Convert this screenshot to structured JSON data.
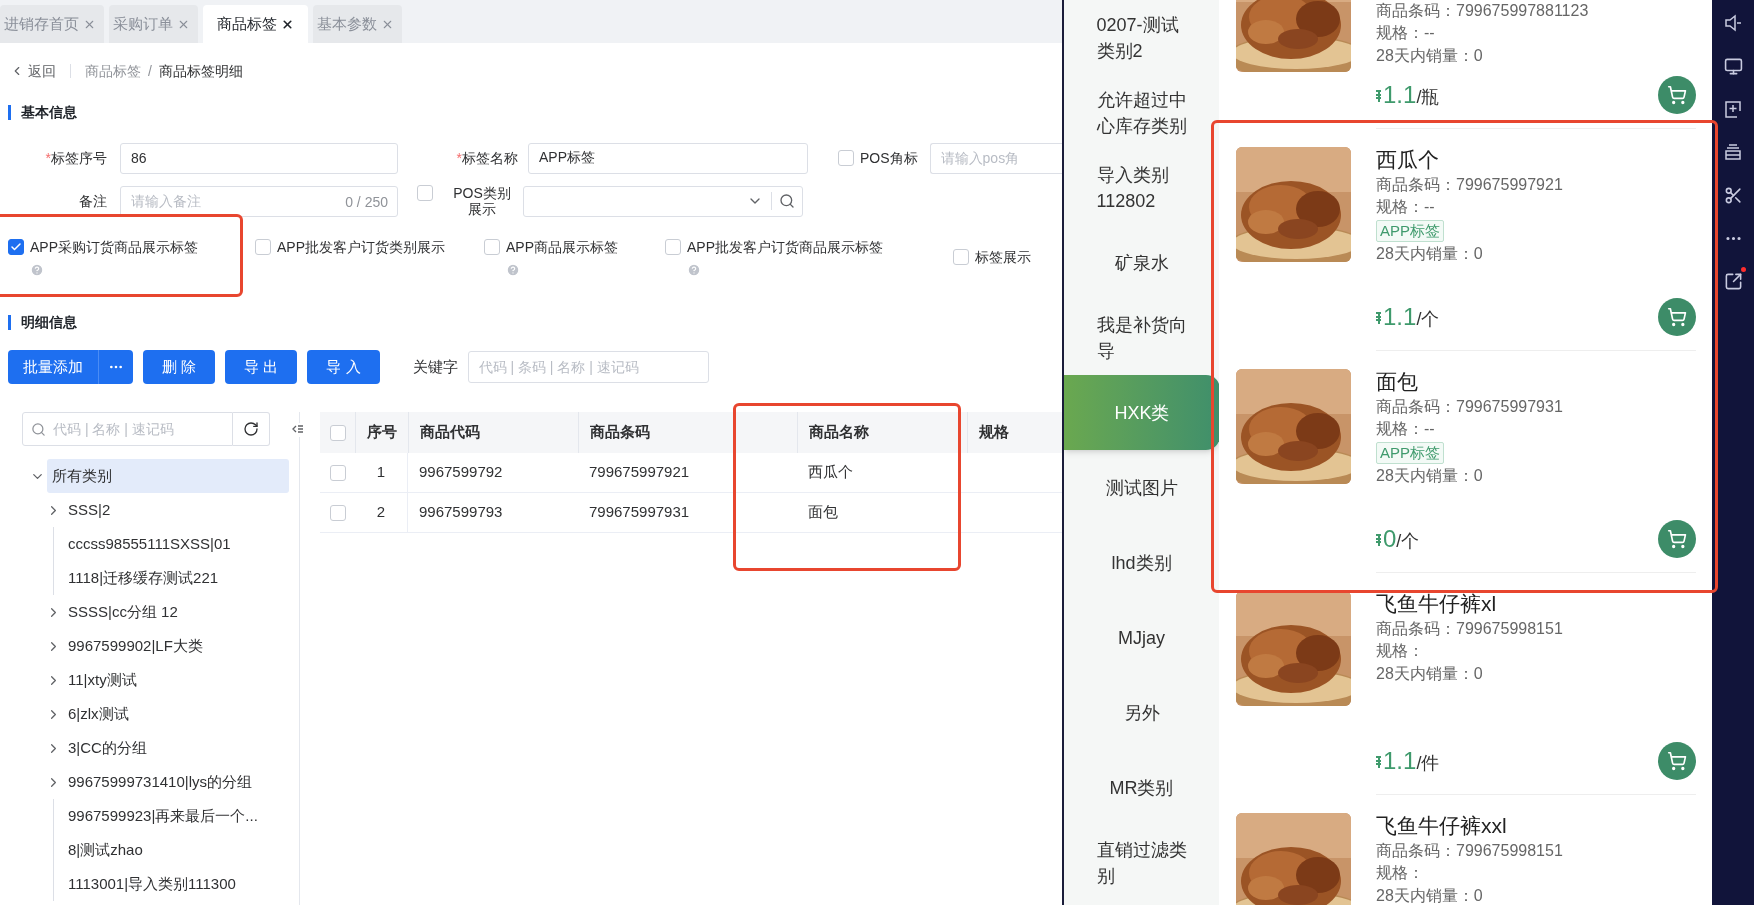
{
  "tabs": [
    {
      "label": "进销存首页",
      "selected": false
    },
    {
      "label": "采购订单",
      "selected": false
    },
    {
      "label": "商品标签",
      "selected": true
    },
    {
      "label": "基本参数",
      "selected": false
    }
  ],
  "breadcrumb": {
    "back": "返回",
    "items": [
      "商品标签",
      "商品标签明细"
    ],
    "separator": "/"
  },
  "basic_info": {
    "title": "基本信息",
    "tag_no": {
      "mark": "*",
      "label": "标签序号",
      "value": "86"
    },
    "tag_name": {
      "mark": "*",
      "label": "标签名称",
      "value": "APP标签"
    },
    "pos_corner": {
      "label": "POS角标",
      "checked": false,
      "placeholder": "请输入pos角"
    },
    "remark": {
      "label": "备注",
      "placeholder": "请输入备注",
      "counter": "0 / 250"
    },
    "pos_category": {
      "label": "POS类别展示",
      "checked": false
    },
    "options": [
      {
        "label": "APP采购订货商品展示标签",
        "checked": true,
        "help": true
      },
      {
        "label": "APP批发客户订货类别展示",
        "checked": false,
        "help": false
      },
      {
        "label": "APP商品展示标签",
        "checked": false,
        "help": true
      },
      {
        "label": "APP批发客户订货商品展示标签",
        "checked": false,
        "help": true
      },
      {
        "label": "标签展示",
        "checked": false,
        "help": false
      }
    ]
  },
  "detail": {
    "title": "明细信息",
    "buttons": [
      {
        "label": "批量添加",
        "kind": "split"
      },
      {
        "label": "删 除",
        "kind": "plain"
      },
      {
        "label": "导 出",
        "kind": "plain"
      },
      {
        "label": "导 入",
        "kind": "plain"
      }
    ],
    "keyword": {
      "label": "关键字",
      "placeholder": "代码 | 条码 | 名称 | 速记码"
    }
  },
  "tree": {
    "search_placeholder": "代码 | 名称 | 速记码",
    "items": [
      {
        "label": "所有类别",
        "kind": "group",
        "expanded": true,
        "selected": true,
        "children": [
          {
            "label": "SSS|2",
            "kind": "group",
            "expanded": false,
            "selected": false
          },
          {
            "label": "cccss98555111SXSS|01",
            "kind": "leaf",
            "selected": false
          },
          {
            "label": "1118|迁移缓存测试221",
            "kind": "leaf",
            "selected": false
          },
          {
            "label": "SSSS|cc分组 12",
            "kind": "group",
            "expanded": false,
            "selected": false
          },
          {
            "label": "9967599902|LF大类",
            "kind": "group",
            "expanded": false,
            "selected": false
          },
          {
            "label": "11|xty测试",
            "kind": "group",
            "expanded": false,
            "selected": false
          },
          {
            "label": "6|zlx测试",
            "kind": "group",
            "expanded": false,
            "selected": false
          },
          {
            "label": "3|CC的分组",
            "kind": "group",
            "expanded": false,
            "selected": false
          },
          {
            "label": "99675999731410|lys的分组",
            "kind": "group",
            "expanded": false,
            "selected": false
          },
          {
            "label": "9967599923|再来最后一个...",
            "kind": "leaf",
            "selected": false
          },
          {
            "label": "8|测试zhao",
            "kind": "leaf",
            "selected": false
          },
          {
            "label": "1113001|导入类别111300",
            "kind": "leaf",
            "selected": false
          }
        ]
      }
    ]
  },
  "table": {
    "all_checked": false,
    "columns": [
      "序号",
      "商品代码",
      "商品条码",
      "商品名称",
      "规格"
    ],
    "rows": [
      {
        "checked": false,
        "cells": [
          "1",
          "9967599792",
          "799675997921",
          "西瓜个"
        ]
      },
      {
        "checked": false,
        "cells": [
          "2",
          "9967599793",
          "799675997931",
          "面包"
        ]
      }
    ]
  },
  "app": {
    "categories": [
      {
        "label": "0207-测试类别2",
        "selected": false
      },
      {
        "label": "允许超过中心库存类别",
        "selected": false
      },
      {
        "label": "导入类别112802",
        "selected": false
      },
      {
        "label": "矿泉水",
        "selected": false
      },
      {
        "label": "我是补货向导",
        "selected": false
      },
      {
        "label": "HXK类",
        "selected": true
      },
      {
        "label": "测试图片",
        "selected": false
      },
      {
        "label": "lhd类别",
        "selected": false
      },
      {
        "label": "MJjay",
        "selected": false
      },
      {
        "label": "另外",
        "selected": false
      },
      {
        "label": "MR类别",
        "selected": false
      },
      {
        "label": "直销过滤类别",
        "selected": false
      }
    ],
    "products": [
      {
        "barcode": "商品条码：799675997881123",
        "spec": "规格：--",
        "sales": "28天内销量：0",
        "price": "1.1",
        "unit": "/瓶"
      },
      {
        "name": "西瓜个",
        "barcode": "商品条码：799675997921",
        "spec": "规格：--",
        "tag": "APP标签",
        "sales": "28天内销量：0",
        "price": "1.1",
        "unit": "/个"
      },
      {
        "name": "面包",
        "barcode": "商品条码：799675997931",
        "spec": "规格：--",
        "tag": "APP标签",
        "sales": "28天内销量：0",
        "price": "0",
        "unit": "/个"
      },
      {
        "name": "飞鱼牛仔裤xl",
        "barcode": "商品条码：799675998151",
        "spec": "规格：",
        "sales": "28天内销量：0",
        "price": "1.1",
        "unit": "/件"
      },
      {
        "name": "飞鱼牛仔裤xxl",
        "barcode": "商品条码：799675998151",
        "spec": "规格：",
        "sales": "28天内销量：0"
      }
    ]
  }
}
